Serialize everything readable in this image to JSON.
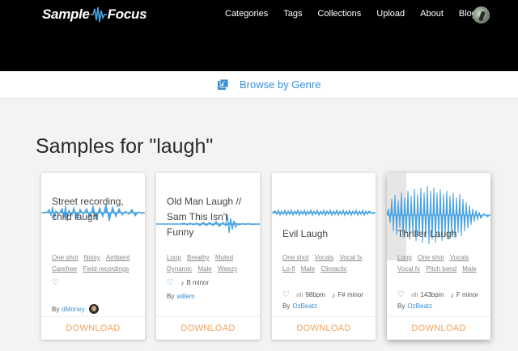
{
  "brand": {
    "name_left": "Sample",
    "name_right": "Focus"
  },
  "nav": [
    {
      "label": "Categories"
    },
    {
      "label": "Tags"
    },
    {
      "label": "Collections"
    },
    {
      "label": "Upload"
    },
    {
      "label": "About"
    },
    {
      "label": "Blog"
    }
  ],
  "genre_bar": {
    "label": "Browse by Genre"
  },
  "results": {
    "title": "Samples for \"laugh\""
  },
  "colors": {
    "accent": "#3b8fd6",
    "download": "#f0a35b",
    "wave": "#4aa3df"
  },
  "cards": [
    {
      "title": "Street recording, child laugh",
      "tags": [
        "One shot",
        "Noisy",
        "Ambient",
        "Carefree",
        "Field recordings"
      ],
      "bpm": "",
      "key": "",
      "author_prefix": "By",
      "author": "dMoney",
      "download": "DOWNLOAD"
    },
    {
      "title": "Old Man Laugh // Sam This Isn't Funny",
      "tags": [
        "Loop",
        "Breathy",
        "Muted",
        "Dynamic",
        "Male",
        "Weezy"
      ],
      "bpm": "",
      "key": "B minor",
      "author_prefix": "By",
      "author": "willem",
      "download": "DOWNLOAD"
    },
    {
      "title": "Evil Laugh",
      "tags": [
        "One shot",
        "Vocals",
        "Vocal fx",
        "Lo-fi",
        "Male",
        "Climactic"
      ],
      "bpm": "98bpm",
      "key": "F# minor",
      "author_prefix": "By",
      "author": "OzBeatz",
      "download": "DOWNLOAD"
    },
    {
      "title": "Thriller Laugh",
      "tags": [
        "Loop",
        "One shot",
        "Vocals",
        "Vocal fx",
        "Pitch bend",
        "Male"
      ],
      "bpm": "143bpm",
      "key": "F minor",
      "author_prefix": "By",
      "author": "OzBeatz",
      "download": "DOWNLOAD"
    }
  ]
}
